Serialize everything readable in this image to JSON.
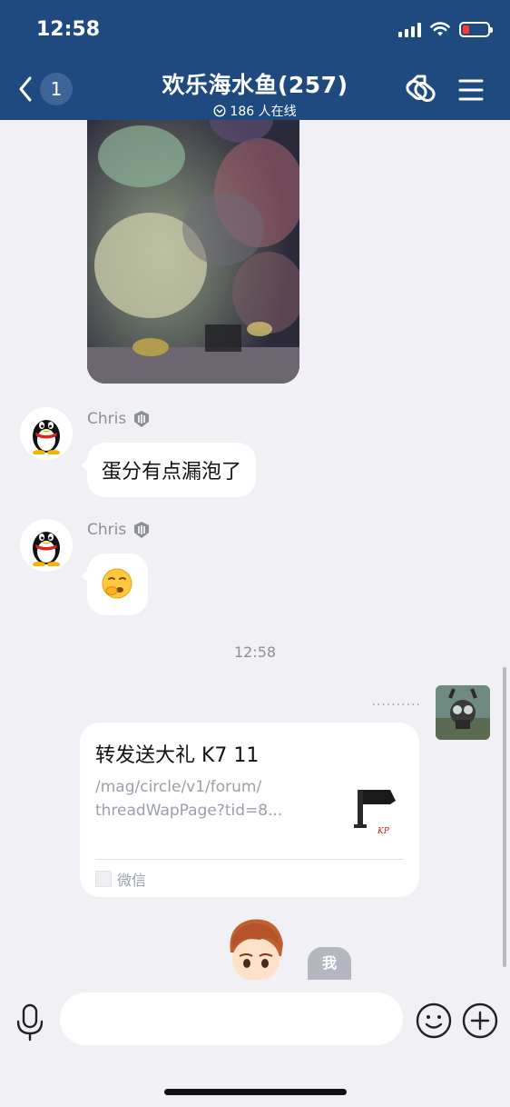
{
  "status_bar": {
    "time": "12:58"
  },
  "header": {
    "back_count": "1",
    "title": "欢乐海水鱼(257)",
    "online": "186 人在线"
  },
  "messages": [
    {
      "type": "image",
      "description": "reef-aquarium-photo"
    },
    {
      "type": "text",
      "sender": "Chris",
      "text": "蛋分有点漏泡了"
    },
    {
      "type": "emoji",
      "sender": "Chris",
      "emoji": "yawn-face"
    }
  ],
  "timestamp": "12:58",
  "share_card": {
    "title": "转发送大礼 K7 11",
    "url": "/mag/circle/v1/forum/threadWapPage?tid=8...",
    "url_line1": "/mag/circle/v1/forum/",
    "url_line2": "threadWapPage?tid=8...",
    "source": "微信",
    "thumb_caption": "KP"
  },
  "me_badge": "我",
  "input": {
    "placeholder": ""
  },
  "colors": {
    "header": "#1e4a80",
    "background": "#f1f1f5",
    "bubble": "#ffffff",
    "battery_low": "#ff3b30"
  }
}
